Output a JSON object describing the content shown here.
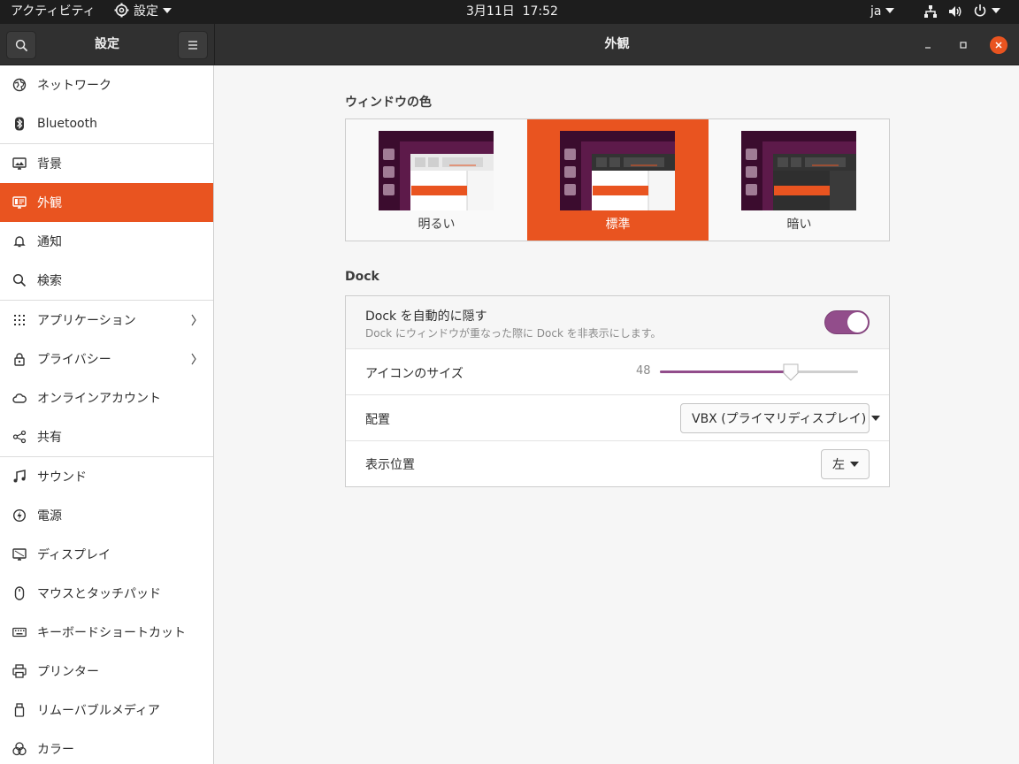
{
  "topbar": {
    "activities": "アクティビティ",
    "app_menu": "設定",
    "clock": "3月11日  17:52",
    "lang": "ja"
  },
  "headerbar": {
    "sidebar_title": "設定",
    "page_title": "外観"
  },
  "sidebar": {
    "items": [
      {
        "label": "ネットワーク",
        "icon": "network-icon"
      },
      {
        "label": "Bluetooth",
        "icon": "bluetooth-icon"
      },
      {
        "label": "背景",
        "icon": "background-icon"
      },
      {
        "label": "外観",
        "icon": "appearance-icon",
        "active": true
      },
      {
        "label": "通知",
        "icon": "bell-icon"
      },
      {
        "label": "検索",
        "icon": "search-icon"
      },
      {
        "label": "アプリケーション",
        "icon": "apps-grid-icon",
        "chevron": true
      },
      {
        "label": "プライバシー",
        "icon": "lock-icon",
        "chevron": true
      },
      {
        "label": "オンラインアカウント",
        "icon": "cloud-icon"
      },
      {
        "label": "共有",
        "icon": "share-icon"
      },
      {
        "label": "サウンド",
        "icon": "music-note-icon"
      },
      {
        "label": "電源",
        "icon": "power-icon"
      },
      {
        "label": "ディスプレイ",
        "icon": "display-icon"
      },
      {
        "label": "マウスとタッチパッド",
        "icon": "mouse-icon"
      },
      {
        "label": "キーボードショートカット",
        "icon": "keyboard-icon"
      },
      {
        "label": "プリンター",
        "icon": "printer-icon"
      },
      {
        "label": "リムーバブルメディア",
        "icon": "removable-media-icon"
      },
      {
        "label": "カラー",
        "icon": "color-icon"
      }
    ]
  },
  "appearance": {
    "window_color_title": "ウィンドウの色",
    "variants": [
      {
        "label": "明るい",
        "selected": false
      },
      {
        "label": "標準",
        "selected": true
      },
      {
        "label": "暗い",
        "selected": false
      }
    ],
    "dock_title": "Dock",
    "autohide_label": "Dock を自動的に隠す",
    "autohide_sub": "Dock にウィンドウが重なった際に Dock を非表示にします。",
    "autohide_on": true,
    "icon_size_label": "アイコンのサイズ",
    "icon_size_value": "48",
    "icon_size_fraction": 0.66,
    "placement_label": "配置",
    "placement_value": "VBX (プライマリディスプレイ)",
    "position_label": "表示位置",
    "position_value": "左"
  },
  "colors": {
    "accent": "#e95420",
    "aubergine": "#924d8b"
  }
}
